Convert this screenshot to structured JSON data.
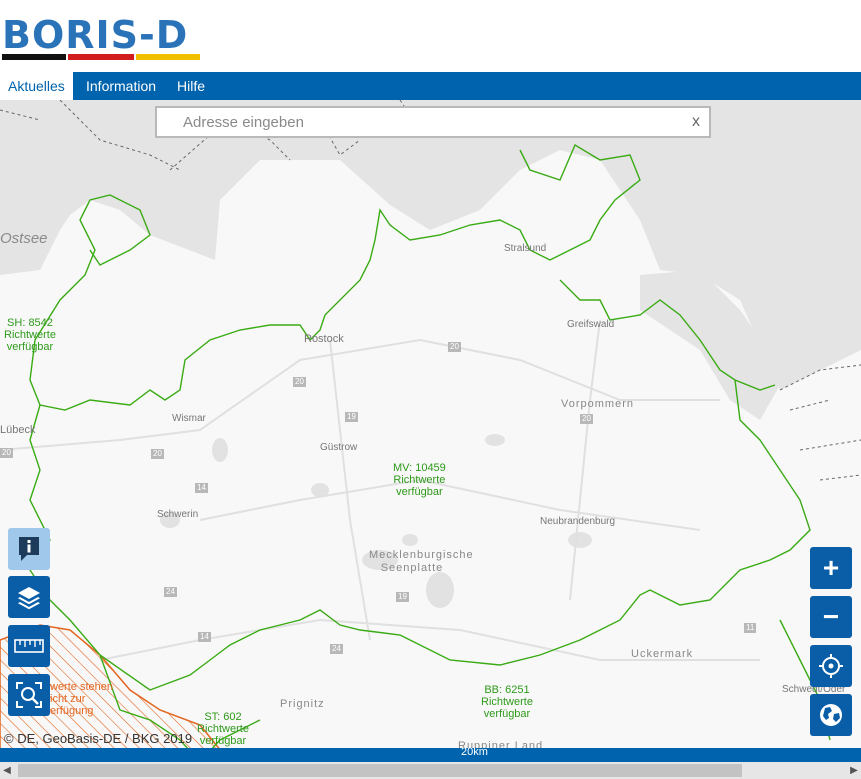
{
  "logo": {
    "text": "BORIS-D",
    "bar_colors": [
      "#111111",
      "#d11d1d",
      "#f0c000"
    ],
    "text_color": "#2b73b8"
  },
  "nav": {
    "items": [
      {
        "label": "Aktuelles",
        "active": true
      },
      {
        "label": "Information",
        "active": false
      },
      {
        "label": "Hilfe",
        "active": false
      }
    ],
    "color": "#0063ad"
  },
  "search": {
    "placeholder": "Adresse eingeben",
    "value": "",
    "clear_label": "x"
  },
  "map": {
    "sea_label": "Ostsee",
    "places": [
      "Stralsund",
      "Greifswald",
      "Rostock",
      "Güstrow",
      "Wismar",
      "Lübeck",
      "Schwerin",
      "Neubrandenburg",
      "Prignitz",
      "Schwedt/Oder",
      "Ruppiner Land"
    ],
    "regions": [
      "Vorpommern",
      "Mecklenburgische Seenplatte",
      "Uckermark"
    ],
    "roads": [
      "20",
      "20",
      "20",
      "20",
      "19",
      "14",
      "24",
      "14",
      "24",
      "19",
      "20",
      "11"
    ],
    "richtwerte": [
      {
        "id": "SH",
        "count_label": "SH: 8542",
        "line1": "Richtwerte",
        "line2": "verfügbar"
      },
      {
        "id": "MV",
        "count_label": "MV: 10459",
        "line1": "Richtwerte",
        "line2": "verfügbar"
      },
      {
        "id": "BB",
        "count_label": "BB: 6251",
        "line1": "Richtwerte",
        "line2": "verfügbar"
      },
      {
        "id": "ST",
        "count_label": "ST: 602",
        "line1": "Richtwerte",
        "line2": "verfügbar"
      }
    ],
    "orange_note": [
      "werte stehen",
      "icht zur",
      "erfügung"
    ],
    "colors": {
      "boundary": "#3aab14",
      "hatch": "#e2661f",
      "land": "#f7f7f7",
      "water": "#e3e3e3"
    }
  },
  "tools": [
    {
      "name": "info-button",
      "icon": "info-icon"
    },
    {
      "name": "layers-button",
      "icon": "layers-icon"
    },
    {
      "name": "measure-button",
      "icon": "ruler-icon"
    },
    {
      "name": "search-map-button",
      "icon": "zoom-search-icon"
    }
  ],
  "zoom": {
    "in_label": "+",
    "out_label": "−",
    "locate_icon": "crosshair-icon",
    "globe_icon": "globe-icon"
  },
  "attribution": "© DE, GeoBasis-DE / BKG 2019",
  "statusbar": {
    "scale": "20km"
  }
}
